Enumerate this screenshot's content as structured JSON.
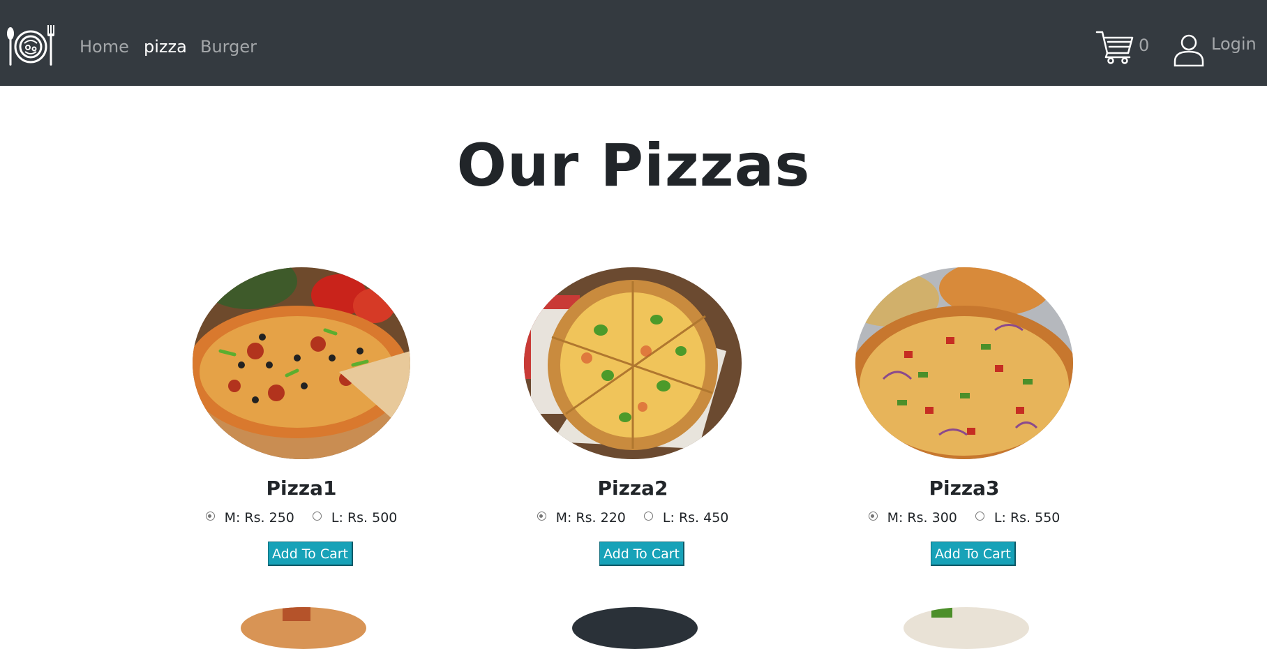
{
  "nav": {
    "links": [
      "Home",
      "pizza",
      "Burger"
    ],
    "active": "pizza",
    "cart_count": "0",
    "login_label": "Login"
  },
  "main": {
    "title": "Our Pizzas",
    "products": [
      {
        "name": "Pizza1",
        "option_m": "M: Rs. 250",
        "option_l": "L: Rs. 500",
        "selected": "M",
        "button": "Add To Cart"
      },
      {
        "name": "Pizza2",
        "option_m": "M: Rs. 220",
        "option_l": "L: Rs. 450",
        "selected": "M",
        "button": "Add To Cart"
      },
      {
        "name": "Pizza3",
        "option_m": "M: Rs. 300",
        "option_l": "L: Rs. 550",
        "selected": "M",
        "button": "Add To Cart"
      }
    ]
  },
  "colors": {
    "navbar": "#343a40",
    "button": "#17a2b8",
    "heading": "#212529"
  },
  "icons": [
    "restaurant-plate-logo-icon",
    "cart-icon",
    "user-icon"
  ]
}
